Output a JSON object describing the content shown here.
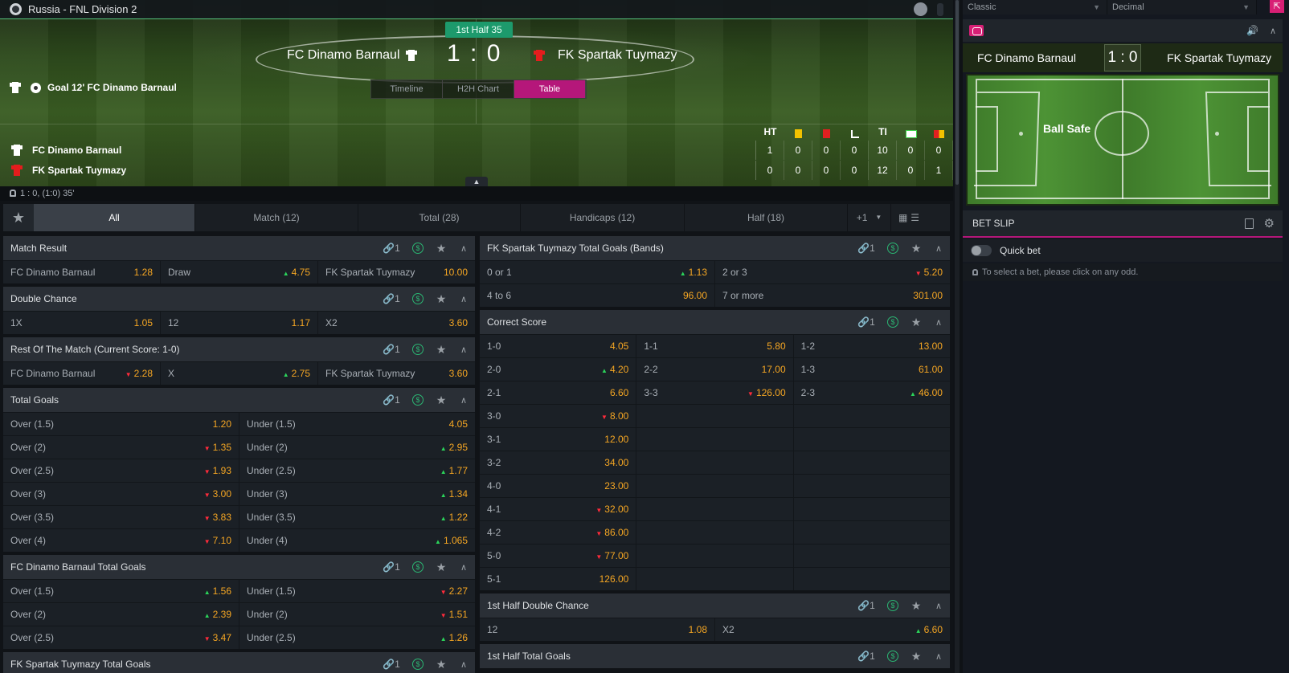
{
  "header": {
    "league": "Russia - FNL Division 2",
    "time": "1st Half 35",
    "home": "FC Dinamo Barnaul",
    "away": "FK Spartak Tuymazy",
    "score": "1 : 0",
    "event": "Goal 12' FC Dinamo Barnaul",
    "tabs": [
      "Timeline",
      "H2H Chart",
      "Table"
    ],
    "active_tab": "Table"
  },
  "stats": {
    "headers": [
      "HT",
      "yellow-card-icon",
      "red-card-icon",
      "corner-icon",
      "TI",
      "substitution-icon",
      "yellow-red-card-icon"
    ],
    "ht_label": "HT",
    "ti_label": "TI",
    "rows": [
      {
        "team": "FC Dinamo Barnaul",
        "vals": [
          "1",
          "0",
          "0",
          "0",
          "10",
          "0",
          "0"
        ]
      },
      {
        "team": "FK Spartak Tuymazy",
        "vals": [
          "0",
          "0",
          "0",
          "0",
          "12",
          "0",
          "1"
        ]
      }
    ]
  },
  "score_line": "1 : 0, (1:0) 35'",
  "market_tabs": [
    {
      "label": "All"
    },
    {
      "label": "Match (12)"
    },
    {
      "label": "Total (28)"
    },
    {
      "label": "Handicaps (12)"
    },
    {
      "label": "Half (18)"
    }
  ],
  "more_tabs": "+1",
  "link_count": "1",
  "colA": [
    {
      "title": "Match Result",
      "rows": [
        [
          [
            "FC Dinamo Barnaul",
            "1.28",
            ""
          ],
          [
            "Draw",
            "4.75",
            "up"
          ],
          [
            "FK Spartak Tuymazy",
            "10.00",
            ""
          ]
        ]
      ]
    },
    {
      "title": "Double Chance",
      "rows": [
        [
          [
            "1X",
            "1.05",
            ""
          ],
          [
            "12",
            "1.17",
            ""
          ],
          [
            "X2",
            "3.60",
            ""
          ]
        ]
      ]
    },
    {
      "title": "Rest Of The Match (Current Score: 1-0)",
      "rows": [
        [
          [
            "FC Dinamo Barnaul",
            "2.28",
            "down"
          ],
          [
            "X",
            "2.75",
            "up"
          ],
          [
            "FK Spartak Tuymazy",
            "3.60",
            ""
          ]
        ]
      ]
    },
    {
      "title": "Total Goals",
      "rows": [
        [
          [
            "Over (1.5)",
            "1.20",
            ""
          ],
          [
            "Under (1.5)",
            "4.05",
            ""
          ]
        ],
        [
          [
            "Over (2)",
            "1.35",
            "down"
          ],
          [
            "Under (2)",
            "2.95",
            "up"
          ]
        ],
        [
          [
            "Over (2.5)",
            "1.93",
            "down"
          ],
          [
            "Under (2.5)",
            "1.77",
            "up"
          ]
        ],
        [
          [
            "Over (3)",
            "3.00",
            "down"
          ],
          [
            "Under (3)",
            "1.34",
            "up"
          ]
        ],
        [
          [
            "Over (3.5)",
            "3.83",
            "down"
          ],
          [
            "Under (3.5)",
            "1.22",
            "up"
          ]
        ],
        [
          [
            "Over (4)",
            "7.10",
            "down"
          ],
          [
            "Under (4)",
            "1.065",
            "up"
          ]
        ]
      ]
    },
    {
      "title": "FC Dinamo Barnaul Total Goals",
      "rows": [
        [
          [
            "Over (1.5)",
            "1.56",
            "up"
          ],
          [
            "Under (1.5)",
            "2.27",
            "down"
          ]
        ],
        [
          [
            "Over (2)",
            "2.39",
            "up"
          ],
          [
            "Under (2)",
            "1.51",
            "down"
          ]
        ],
        [
          [
            "Over (2.5)",
            "3.47",
            "down"
          ],
          [
            "Under (2.5)",
            "1.26",
            "up"
          ]
        ]
      ]
    },
    {
      "title": "FK Spartak Tuymazy Total Goals",
      "rows": []
    }
  ],
  "colB": [
    {
      "title": "FK Spartak Tuymazy Total Goals (Bands)",
      "rows": [
        [
          [
            "0 or 1",
            "1.13",
            "up"
          ],
          [
            "2 or 3",
            "5.20",
            "down"
          ]
        ],
        [
          [
            "4 to 6",
            "96.00",
            ""
          ],
          [
            "7 or more",
            "301.00",
            ""
          ]
        ]
      ]
    },
    {
      "title": "Correct Score",
      "rows": [
        [
          [
            "1-0",
            "4.05",
            ""
          ],
          [
            "1-1",
            "5.80",
            ""
          ],
          [
            "1-2",
            "13.00",
            ""
          ]
        ],
        [
          [
            "2-0",
            "4.20",
            "up"
          ],
          [
            "2-2",
            "17.00",
            ""
          ],
          [
            "1-3",
            "61.00",
            ""
          ]
        ],
        [
          [
            "2-1",
            "6.60",
            ""
          ],
          [
            "3-3",
            "126.00",
            "down"
          ],
          [
            "2-3",
            "46.00",
            "up"
          ]
        ],
        [
          [
            "3-0",
            "8.00",
            "down"
          ],
          [
            "",
            "",
            ""
          ],
          [
            "",
            "",
            ""
          ]
        ],
        [
          [
            "3-1",
            "12.00",
            ""
          ],
          [
            "",
            "",
            ""
          ],
          [
            "",
            "",
            ""
          ]
        ],
        [
          [
            "3-2",
            "34.00",
            ""
          ],
          [
            "",
            "",
            ""
          ],
          [
            "",
            "",
            ""
          ]
        ],
        [
          [
            "4-0",
            "23.00",
            ""
          ],
          [
            "",
            "",
            ""
          ],
          [
            "",
            "",
            ""
          ]
        ],
        [
          [
            "4-1",
            "32.00",
            "down"
          ],
          [
            "",
            "",
            ""
          ],
          [
            "",
            "",
            ""
          ]
        ],
        [
          [
            "4-2",
            "86.00",
            "down"
          ],
          [
            "",
            "",
            ""
          ],
          [
            "",
            "",
            ""
          ]
        ],
        [
          [
            "5-0",
            "77.00",
            "down"
          ],
          [
            "",
            "",
            ""
          ],
          [
            "",
            "",
            ""
          ]
        ],
        [
          [
            "5-1",
            "126.00",
            ""
          ],
          [
            "",
            "",
            ""
          ],
          [
            "",
            "",
            ""
          ]
        ]
      ]
    },
    {
      "title": "1st Half Double Chance",
      "rows": [
        [
          [
            "12",
            "1.08",
            ""
          ],
          [
            "X2",
            "6.60",
            "up"
          ]
        ]
      ]
    },
    {
      "title": "1st Half Total Goals",
      "rows": []
    }
  ],
  "right": {
    "format": "Classic",
    "odds_format": "Decimal",
    "home": "FC Dinamo Barnaul",
    "away": "FK Spartak Tuymazy",
    "score": "1 : 0",
    "pitch_state": "Ball Safe",
    "betslip": "BET SLIP",
    "quick_bet": "Quick bet",
    "hint": "To select a bet, please click on any odd."
  },
  "colors": {
    "accent": "#b5177a",
    "odds": "#f5a623",
    "up": "#2bd45a",
    "down": "#ff2b3b",
    "live": "#1d9a6c"
  }
}
